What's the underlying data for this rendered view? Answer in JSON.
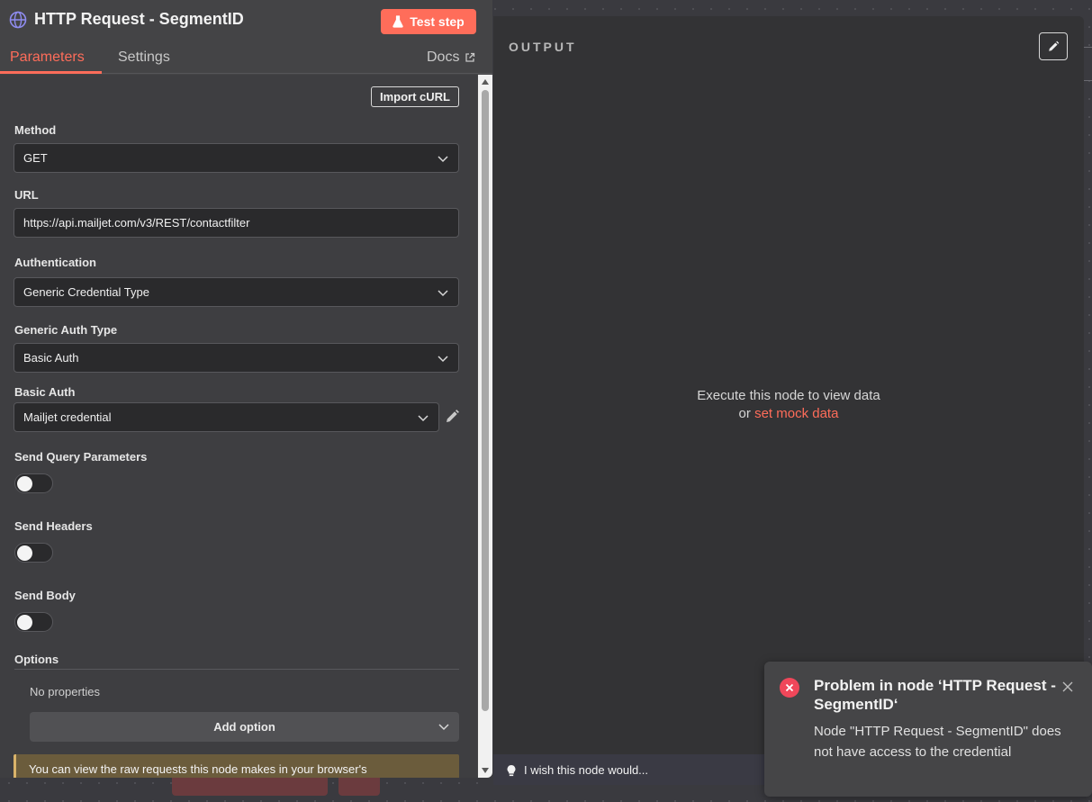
{
  "node": {
    "title": "HTTP Request - SegmentID",
    "test_button": "Test step"
  },
  "tabs": {
    "parameters": "Parameters",
    "settings": "Settings",
    "docs": "Docs"
  },
  "params": {
    "import_curl": "Import cURL",
    "method_label": "Method",
    "method_value": "GET",
    "url_label": "URL",
    "url_value": "https://api.mailjet.com/v3/REST/contactfilter",
    "auth_label": "Authentication",
    "auth_value": "Generic Credential Type",
    "generic_auth_label": "Generic Auth Type",
    "generic_auth_value": "Basic Auth",
    "basic_auth_label": "Basic Auth",
    "basic_auth_value": "Mailjet credential",
    "send_query_label": "Send Query Parameters",
    "send_headers_label": "Send Headers",
    "send_body_label": "Send Body",
    "options_label": "Options",
    "no_properties": "No properties",
    "add_option": "Add option",
    "notice": "You can view the raw requests this node makes in your browser's"
  },
  "toggles": {
    "send_query": false,
    "send_headers": false,
    "send_body": false
  },
  "output": {
    "label": "OUTPUT",
    "exec_msg": "Execute this node to view data",
    "or": "or",
    "mock_link": "set mock data"
  },
  "wish": {
    "text": "I wish this node would..."
  },
  "toast": {
    "title": "Problem in node ‘HTTP Request - SegmentID‘",
    "body": "Node \"HTTP Request - SegmentID\" does not have access to the credential"
  },
  "colors": {
    "accent": "#ff6d5a",
    "error": "#f0475a"
  }
}
